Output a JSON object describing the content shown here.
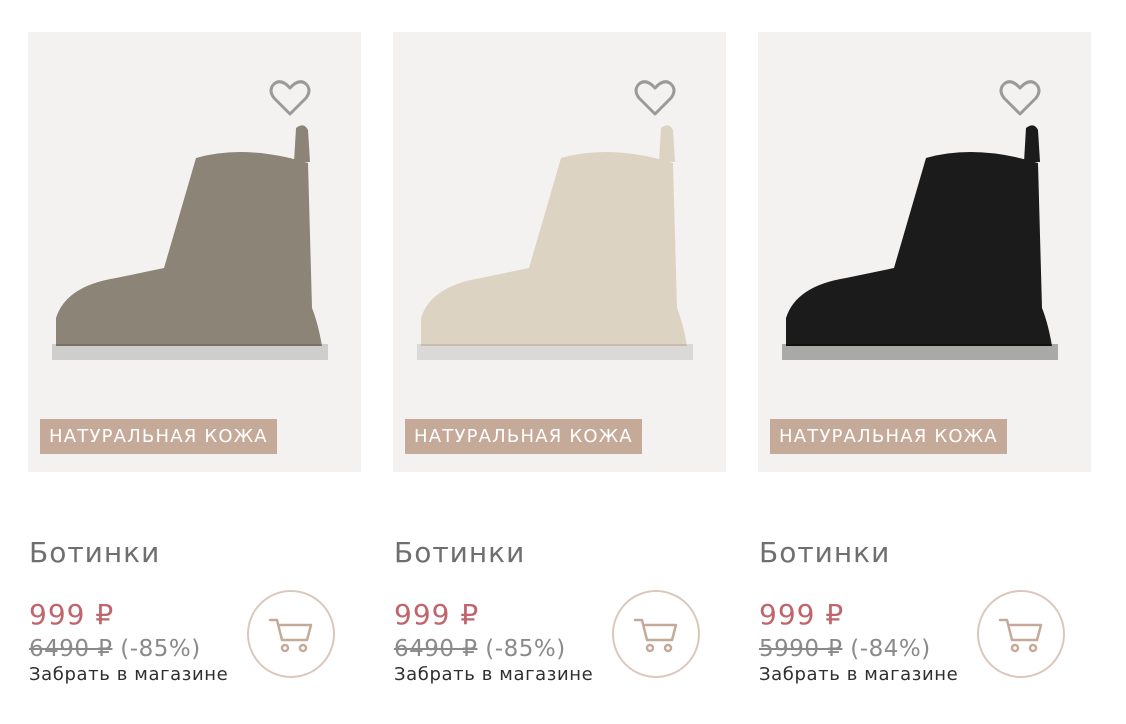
{
  "products": [
    {
      "badge": "НАТУРАЛЬНАЯ КОЖА",
      "title": "Ботинки",
      "price": "999 ₽",
      "old_price": "6490 ₽",
      "discount": "(-85%)",
      "pickup": "Забрать в магазине",
      "color": "#8c8477"
    },
    {
      "badge": "НАТУРАЛЬНАЯ КОЖА",
      "title": "Ботинки",
      "price": "999 ₽",
      "old_price": "6490 ₽",
      "discount": "(-85%)",
      "pickup": "Забрать в магазине",
      "color": "#ddd3c3"
    },
    {
      "badge": "НАТУРАЛЬНАЯ КОЖА",
      "title": "Ботинки",
      "price": "999 ₽",
      "old_price": "5990 ₽",
      "discount": "(-84%)",
      "pickup": "Забрать в магазине",
      "color": "#1b1b1b"
    }
  ],
  "icons": {
    "favorite": "heart-icon",
    "cart": "shopping-cart-icon"
  },
  "colors": {
    "price": "#c0656b",
    "badge_bg": "#c6aa99",
    "photo_bg": "#f3f2f1",
    "cart_border": "#dbc8bd"
  }
}
